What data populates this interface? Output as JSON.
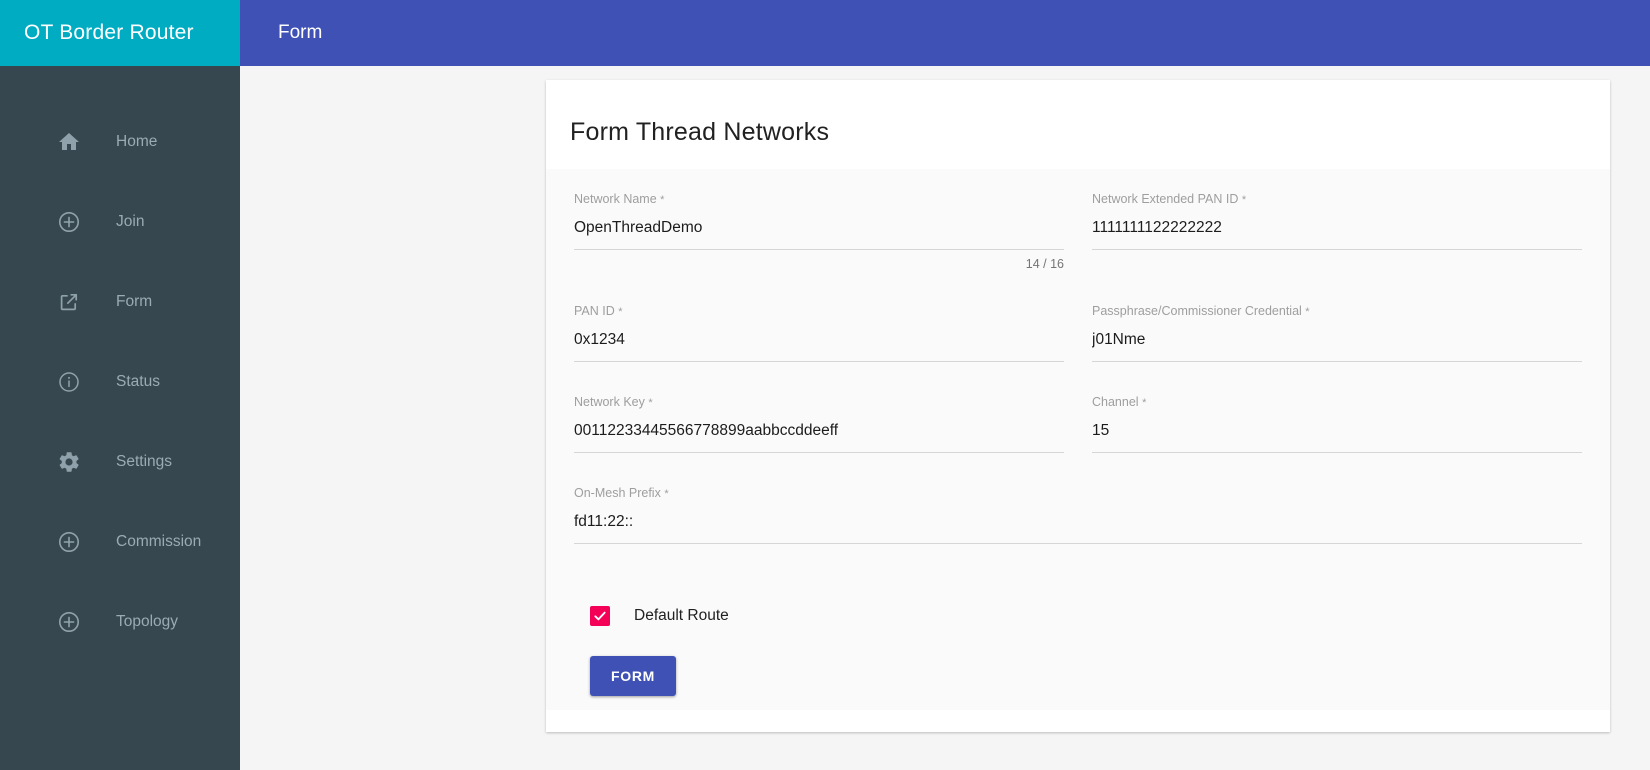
{
  "brand": {
    "title": "OT Border Router"
  },
  "appbar": {
    "title": "Form"
  },
  "sidebar": {
    "items": [
      {
        "label": "Home",
        "icon": "home-icon"
      },
      {
        "label": "Join",
        "icon": "plus-circle-icon"
      },
      {
        "label": "Form",
        "icon": "open-in-new-icon"
      },
      {
        "label": "Status",
        "icon": "info-circle-icon"
      },
      {
        "label": "Settings",
        "icon": "gear-icon"
      },
      {
        "label": "Commission",
        "icon": "plus-circle-icon"
      },
      {
        "label": "Topology",
        "icon": "plus-circle-icon"
      }
    ]
  },
  "card": {
    "title": "Form Thread Networks",
    "fields": {
      "network_name": {
        "label": "Network Name",
        "required_marker": "*",
        "value": "OpenThreadDemo",
        "counter": "14 / 16"
      },
      "ext_pan_id": {
        "label": "Network Extended PAN ID",
        "required_marker": "*",
        "value": "1111111122222222"
      },
      "pan_id": {
        "label": "PAN ID",
        "required_marker": "*",
        "value": "0x1234"
      },
      "passphrase": {
        "label": "Passphrase/Commissioner Credential",
        "required_marker": "*",
        "value": "j01Nme"
      },
      "network_key": {
        "label": "Network Key",
        "required_marker": "*",
        "value": "00112233445566778899aabbccddeeff"
      },
      "channel": {
        "label": "Channel",
        "required_marker": "*",
        "value": "15"
      },
      "on_mesh_prefix": {
        "label": "On-Mesh Prefix",
        "required_marker": "*",
        "value": "fd11:22::"
      }
    },
    "default_route": {
      "label": "Default Route",
      "checked": true,
      "color": "#f50057"
    },
    "submit": {
      "label": "FORM",
      "color": "#3f51b5"
    }
  },
  "colors": {
    "brand_teal": "#00acc1",
    "appbar_indigo": "#3f51b5",
    "sidebar_dark": "#37474f",
    "page_bg": "#f5f5f5",
    "accent_pink": "#f50057"
  }
}
